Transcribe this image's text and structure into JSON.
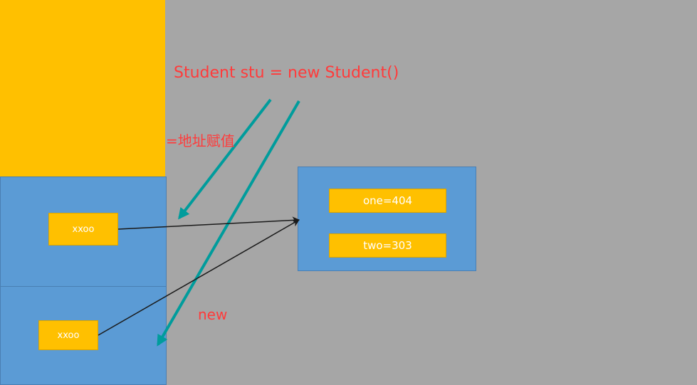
{
  "labels": {
    "code": "Student stu = new Student()",
    "assign": "=地址赋值",
    "new": "new"
  },
  "stack": {
    "frame_1_ref": "xxoo",
    "frame_2_ref": "xxoo"
  },
  "heap": {
    "field_one": "one=404",
    "field_two": "two=303"
  },
  "colors": {
    "background": "#a6a6a6",
    "stack_top": "#ffc000",
    "frame": "#5b9bd5",
    "cell": "#ffc000",
    "arrow_teal": "#009c9c",
    "text_red": "#ff3b3b"
  }
}
